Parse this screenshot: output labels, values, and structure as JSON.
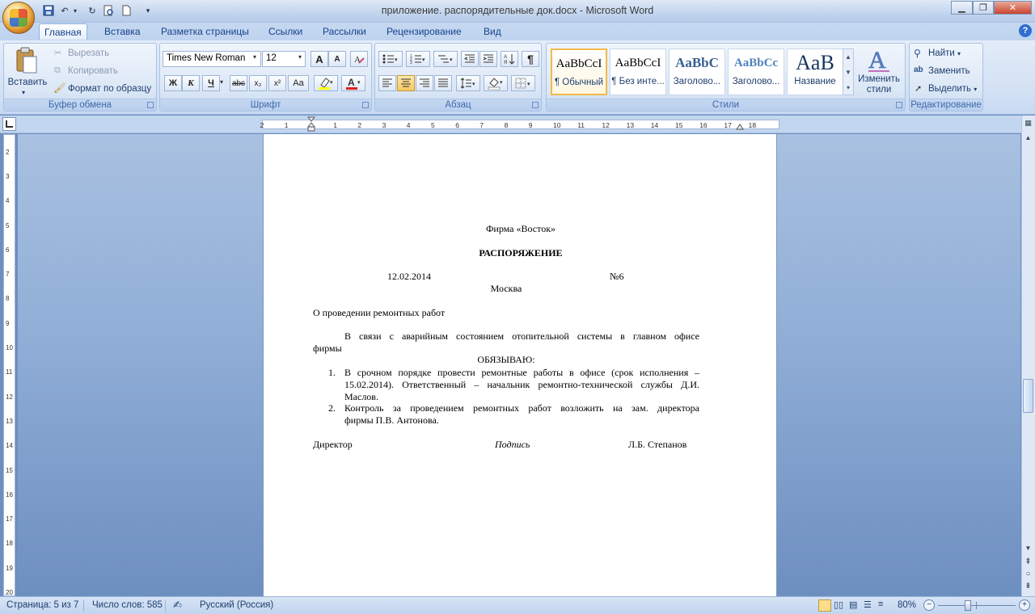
{
  "window": {
    "title": "приложение. распорядительные док.docx - Microsoft Word"
  },
  "tabs": [
    "Главная",
    "Вставка",
    "Разметка страницы",
    "Ссылки",
    "Рассылки",
    "Рецензирование",
    "Вид"
  ],
  "ribbon": {
    "clipboard": {
      "label": "Буфер обмена",
      "paste": "Вставить",
      "cut": "Вырезать",
      "copy": "Копировать",
      "format_painter": "Формат по образцу"
    },
    "font": {
      "label": "Шрифт",
      "font_name": "Times New Roman",
      "font_size": "12",
      "bold": "Ж",
      "italic": "К",
      "underline": "Ч",
      "strike": "abc",
      "sub": "x₂",
      "sup": "x²",
      "case": "Aa",
      "grow": "A",
      "shrink": "A"
    },
    "paragraph": {
      "label": "Абзац",
      "pilcrow": "¶"
    },
    "styles": {
      "label": "Стили",
      "items": [
        {
          "preview": "AaBbCcI",
          "name": "¶ Обычный"
        },
        {
          "preview": "AaBbCcI",
          "name": "¶ Без инте..."
        },
        {
          "preview": "AaBbC",
          "name": "Заголово..."
        },
        {
          "preview": "AaBbCc",
          "name": "Заголово..."
        },
        {
          "preview": "AaB",
          "name": "Название"
        }
      ],
      "change_styles": "Изменить стили"
    },
    "editing": {
      "label": "Редактирование",
      "find": "Найти",
      "replace": "Заменить",
      "select": "Выделить"
    }
  },
  "document": {
    "company": "Фирма «Восток»",
    "doc_type": "РАСПОРЯЖЕНИЕ",
    "date": "12.02.2014",
    "number": "№6",
    "city": "Москва",
    "subject": "О проведении ремонтных работ",
    "preamble_line1": "В связи с аварийным состоянием отопительной системы в главном офисе",
    "preamble_line2": "фирмы",
    "obligate": "ОБЯЗЫВАЮ:",
    "items": [
      {
        "num": "1.",
        "line1": "В срочном порядке провести ремонтные работы в офисе (срок исполнения –",
        "line2": "15.02.2014). Ответственный – начальник ремонтно-технической службы Д.И.",
        "line3": "Маслов."
      },
      {
        "num": "2.",
        "line1": "Контроль за проведением ремонтных работ возложить на зам. директора",
        "line2": "фирмы П.В. Антонова."
      }
    ],
    "signature": {
      "position": "Директор",
      "sign": "Подпись",
      "name": "Л.Б. Степанов"
    }
  },
  "status_bar": {
    "page": "Страница: 5 из 7",
    "words": "Число слов: 585",
    "language": "Русский (Россия)",
    "zoom": "80%"
  },
  "colors": {
    "accent": "#15428b",
    "ribbon_bg": "#dbe7f6",
    "workspace": "#6d8fc0",
    "style_highlight": "#f2ba4c"
  }
}
